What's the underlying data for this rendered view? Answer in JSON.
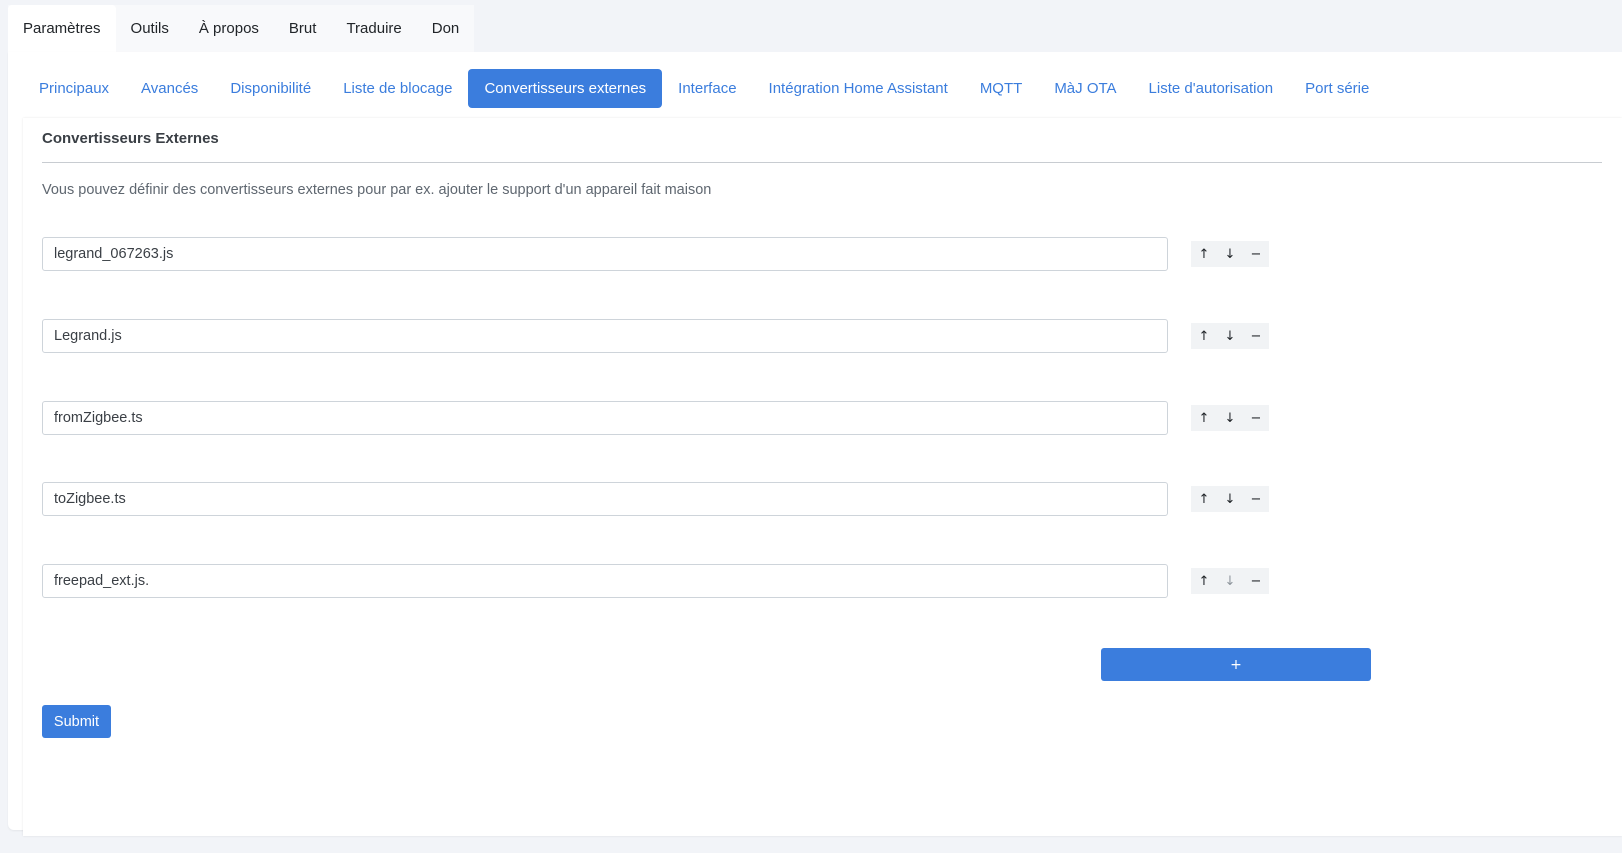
{
  "colors": {
    "accent": "#3b7ddd",
    "background": "#f2f4f8",
    "panel": "#ffffff"
  },
  "top_tabs": [
    {
      "label": "Paramètres",
      "active": true
    },
    {
      "label": "Outils"
    },
    {
      "label": "À propos"
    },
    {
      "label": "Brut"
    },
    {
      "label": "Traduire"
    },
    {
      "label": "Don"
    }
  ],
  "settings_tabs": [
    {
      "label": "Principaux"
    },
    {
      "label": "Avancés"
    },
    {
      "label": "Disponibilité"
    },
    {
      "label": "Liste de blocage"
    },
    {
      "label": "Convertisseurs externes",
      "active": true
    },
    {
      "label": "Interface"
    },
    {
      "label": "Intégration Home Assistant"
    },
    {
      "label": "MQTT"
    },
    {
      "label": "MàJ OTA"
    },
    {
      "label": "Liste d'autorisation"
    },
    {
      "label": "Port série"
    }
  ],
  "section": {
    "title": "Convertisseurs Externes",
    "description": "Vous pouvez définir des convertisseurs externes pour par ex. ajouter le support d'un appareil fait maison"
  },
  "converters": [
    {
      "value": "legrand_067263.js"
    },
    {
      "value": "Legrand.js"
    },
    {
      "value": "fromZigbee.ts"
    },
    {
      "value": "toZigbee.ts"
    },
    {
      "value": "freepad_ext.js."
    }
  ],
  "row_buttons": {
    "up_icon": "arrow-up-icon",
    "up": "↑",
    "down_icon": "arrow-down-icon",
    "down": "↓",
    "remove_icon": "minus-icon",
    "remove": "−"
  },
  "actions": {
    "add_label": "+",
    "submit_label": "Submit"
  }
}
